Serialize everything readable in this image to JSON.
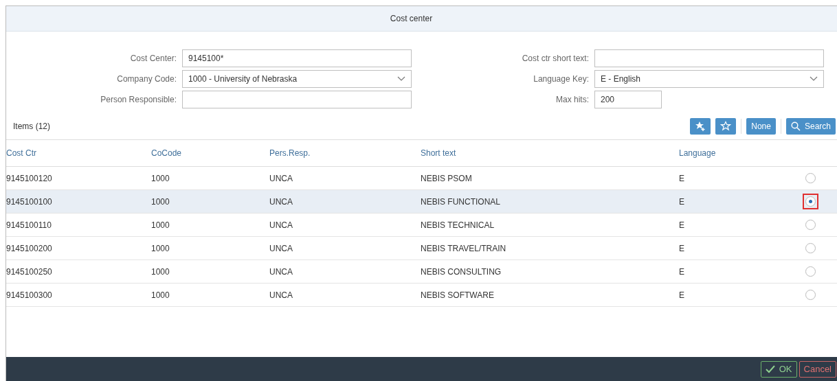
{
  "window": {
    "title": "Cost center"
  },
  "form_left": [
    {
      "label": "Cost Center:",
      "value": "9145100*",
      "kind": "text"
    },
    {
      "label": "Company Code:",
      "value": "1000 - University of Nebraska",
      "kind": "select"
    },
    {
      "label": "Person Responsible:",
      "kind": "text"
    }
  ],
  "form_right": [
    {
      "label": "Cost ctr short text:",
      "kind": "text"
    },
    {
      "label": "Language Key:",
      "value": "E - English",
      "kind": "select"
    },
    {
      "label": "Max hits:",
      "value": "200",
      "kind": "short"
    }
  ],
  "items_title": "Items (12)",
  "toolbar": {
    "none_button": "None",
    "search_button": "Search"
  },
  "table": {
    "columns": [
      "Cost Ctr",
      "CoCode",
      "Pers.Resp.",
      "Short text",
      "Language"
    ],
    "rows": [
      {
        "cells": [
          "9145100120",
          "1000",
          "UNCA",
          "NEBIS PSOM",
          "E"
        ],
        "selected": false,
        "highlighted": false
      },
      {
        "cells": [
          "9145100100",
          "1000",
          "UNCA",
          "NEBIS FUNCTIONAL",
          "E"
        ],
        "selected": true,
        "highlighted": true
      },
      {
        "cells": [
          "9145100110",
          "1000",
          "UNCA",
          "NEBIS TECHNICAL",
          "E"
        ],
        "selected": false,
        "highlighted": false
      },
      {
        "cells": [
          "9145100200",
          "1000",
          "UNCA",
          "NEBIS TRAVEL/TRAIN",
          "E"
        ],
        "selected": false,
        "highlighted": false
      },
      {
        "cells": [
          "9145100250",
          "1000",
          "UNCA",
          "NEBIS CONSULTING",
          "E"
        ],
        "selected": false,
        "highlighted": false
      },
      {
        "cells": [
          "9145100300",
          "1000",
          "UNCA",
          "NEBIS SOFTWARE",
          "E"
        ],
        "selected": false,
        "highlighted": false
      }
    ]
  },
  "footer": {
    "ok": "OK",
    "cancel": "Cancel"
  }
}
